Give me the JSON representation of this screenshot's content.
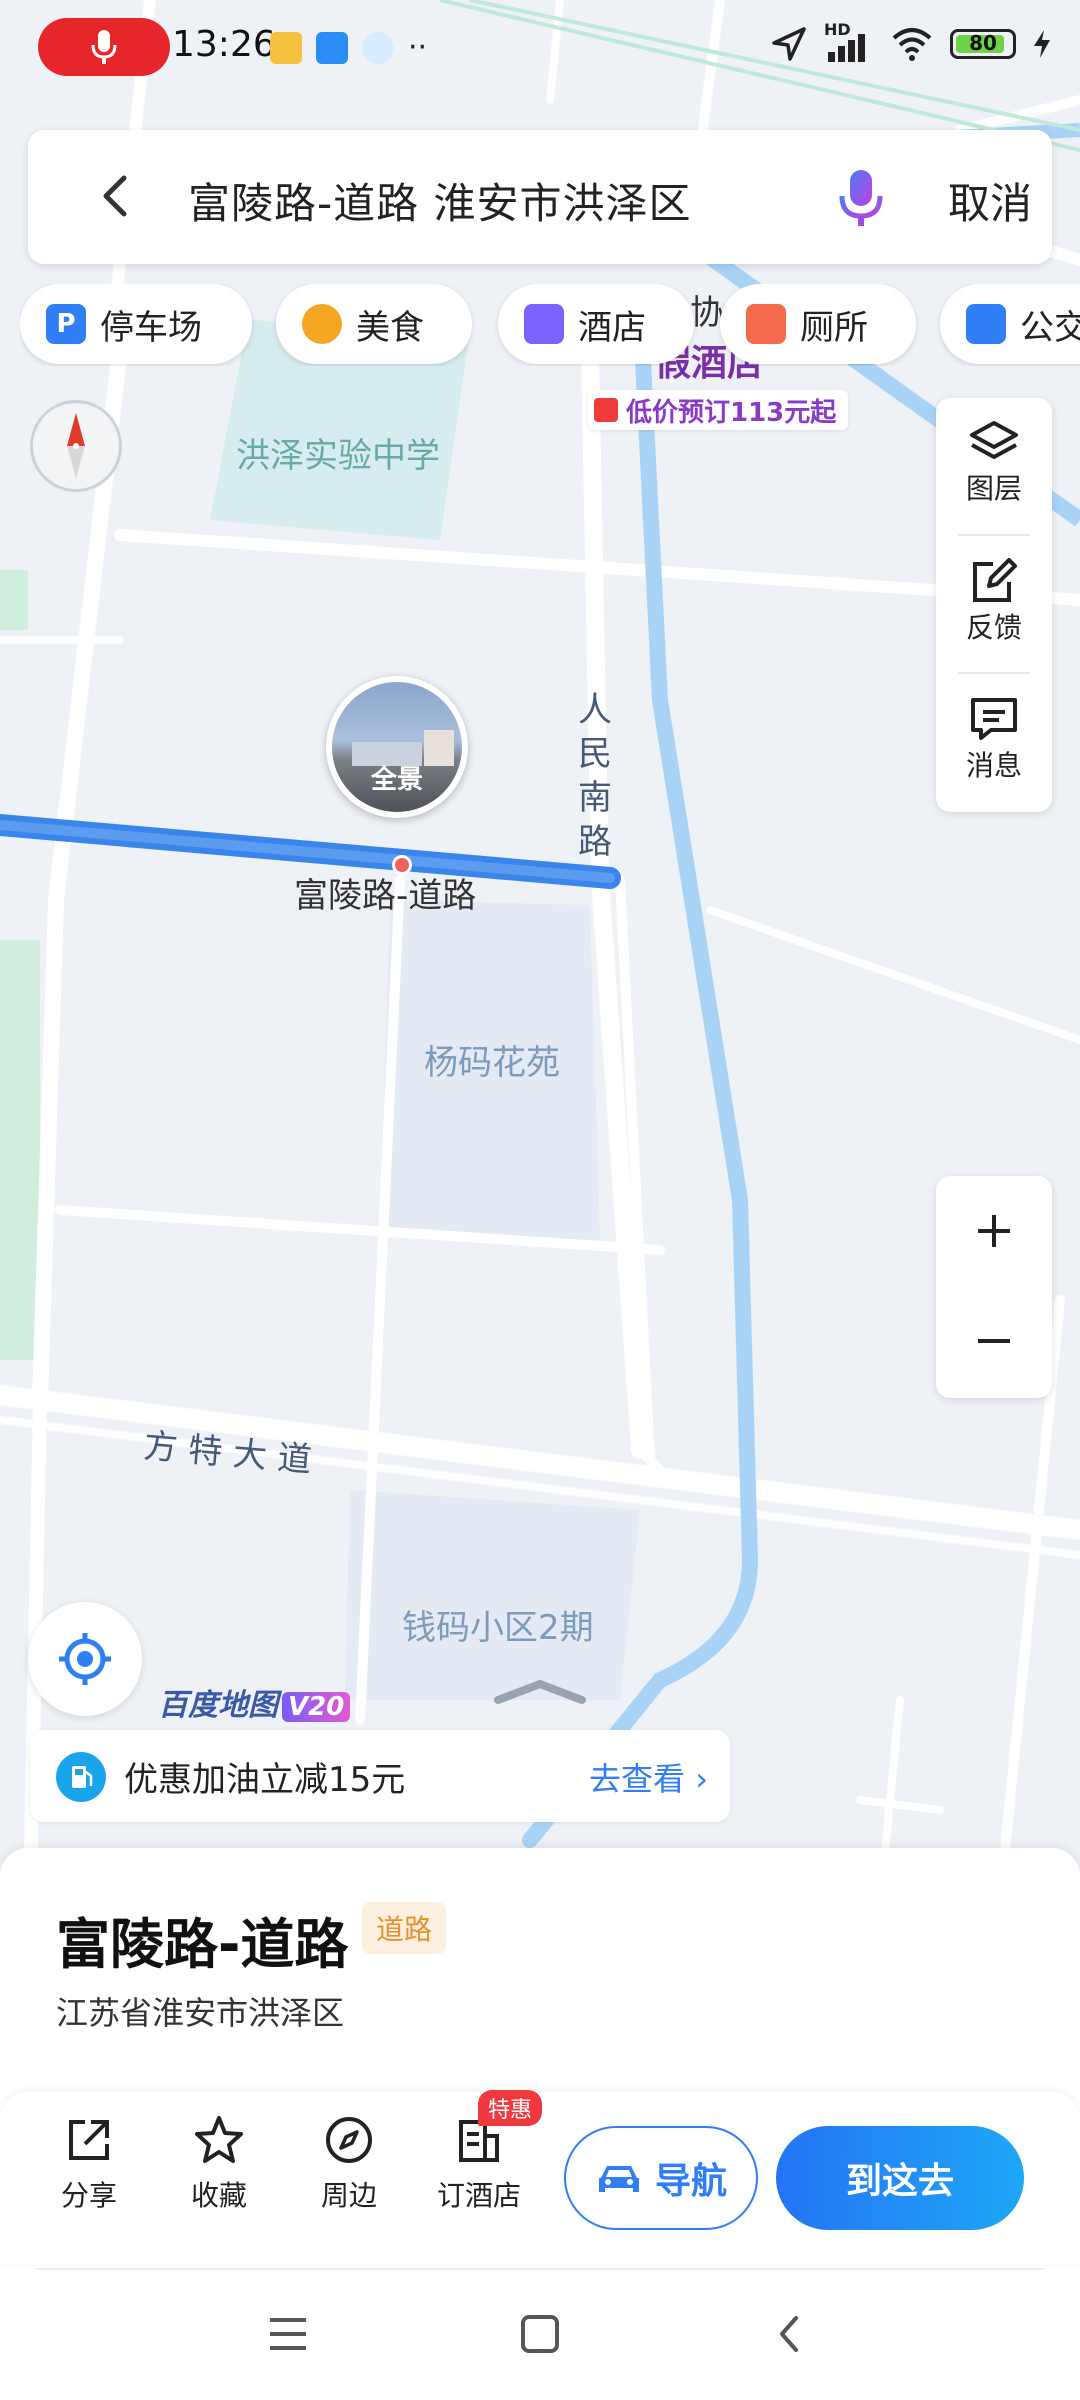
{
  "status": {
    "time": "13:26",
    "hd": "HD",
    "battery": "80"
  },
  "search": {
    "query": "富陵路-道路 淮安市洪泽区",
    "cancel": "取消"
  },
  "chips": [
    {
      "label": "停车场",
      "icon": "parking-icon",
      "color": "#2f7ef5"
    },
    {
      "label": "美食",
      "icon": "food-icon",
      "color": "#f5a623"
    },
    {
      "label": "酒店",
      "icon": "hotel-icon",
      "color": "#7b61ff"
    },
    {
      "label": "厕所",
      "icon": "toilet-icon",
      "color": "#f56a4a"
    },
    {
      "label": "公交",
      "icon": "bus-icon",
      "color": "#2f7ef5"
    }
  ],
  "side_panel": {
    "layers": "图层",
    "feedback": "反馈",
    "messages": "消息"
  },
  "map": {
    "school": "洪泽实验中学",
    "hotel_partial": "协",
    "hotel_name_partial": "假酒店",
    "hotel_promo": "低价预订113元起",
    "street_view": "全景",
    "selected_road": "富陵路-道路",
    "renmin_road": [
      "人",
      "民",
      "南",
      "路"
    ],
    "garden": "杨码花苑",
    "avenue": "方 特 大 道",
    "community": "钱码小区2期",
    "logo": "百度地图",
    "logo_version": "V20"
  },
  "promo": {
    "text": "优惠加油立减15元",
    "link": "去查看"
  },
  "place": {
    "name": "富陵路-道路",
    "tag": "道路",
    "address": "江苏省淮安市洪泽区"
  },
  "actions": {
    "share": "分享",
    "favorite": "收藏",
    "nearby": "周边",
    "hotel": "订酒店",
    "hotel_badge": "特惠",
    "navigate": "导航",
    "go_here": "到这去"
  }
}
